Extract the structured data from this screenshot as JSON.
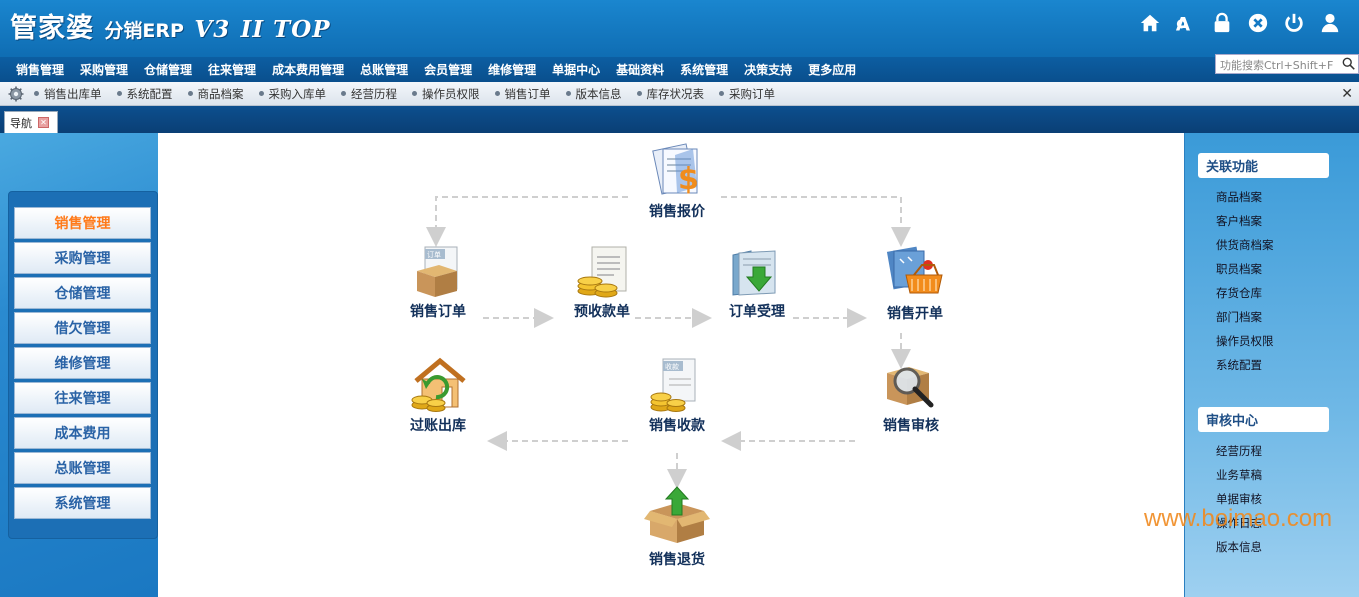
{
  "header": {
    "brand": "管家婆",
    "product": "分销ERP",
    "version": "V3",
    "edition": "II TOP",
    "icons": [
      "home-icon",
      "font-size-icon",
      "lock-icon",
      "close-circle-icon",
      "power-icon",
      "user-icon"
    ]
  },
  "menu": [
    "销售管理",
    "采购管理",
    "仓储管理",
    "往来管理",
    "成本费用管理",
    "总账管理",
    "会员管理",
    "维修管理",
    "单据中心",
    "基础资料",
    "系统管理",
    "决策支持",
    "更多应用"
  ],
  "search": {
    "placeholder": "功能搜索Ctrl+Shift+F"
  },
  "quickbar": [
    "销售出库单",
    "系统配置",
    "商品档案",
    "采购入库单",
    "经营历程",
    "操作员权限",
    "销售订单",
    "版本信息",
    "库存状况表",
    "采购订单"
  ],
  "tab": {
    "label": "导航"
  },
  "leftnav": [
    "销售管理",
    "采购管理",
    "仓储管理",
    "借欠管理",
    "维修管理",
    "往来管理",
    "成本费用",
    "总账管理",
    "系统管理"
  ],
  "flow": {
    "quote": "销售报价",
    "order": "销售订单",
    "prepay": "预收款单",
    "accept": "订单受理",
    "invoice": "销售开单",
    "posting": "过账出库",
    "collect": "销售收款",
    "audit": "销售审核",
    "return": "销售退货",
    "order_tag": "订单",
    "collect_tag": "收款"
  },
  "right": {
    "related_title": "关联功能",
    "related": [
      "商品档案",
      "客户档案",
      "供货商档案",
      "职员档案",
      "存货仓库",
      "部门档案",
      "操作员权限",
      "系统配置"
    ],
    "audit_title": "审核中心",
    "audit": [
      "经营历程",
      "业务草稿",
      "单据审核",
      "操作日志",
      "版本信息"
    ]
  },
  "watermark": "www.boimao.com"
}
